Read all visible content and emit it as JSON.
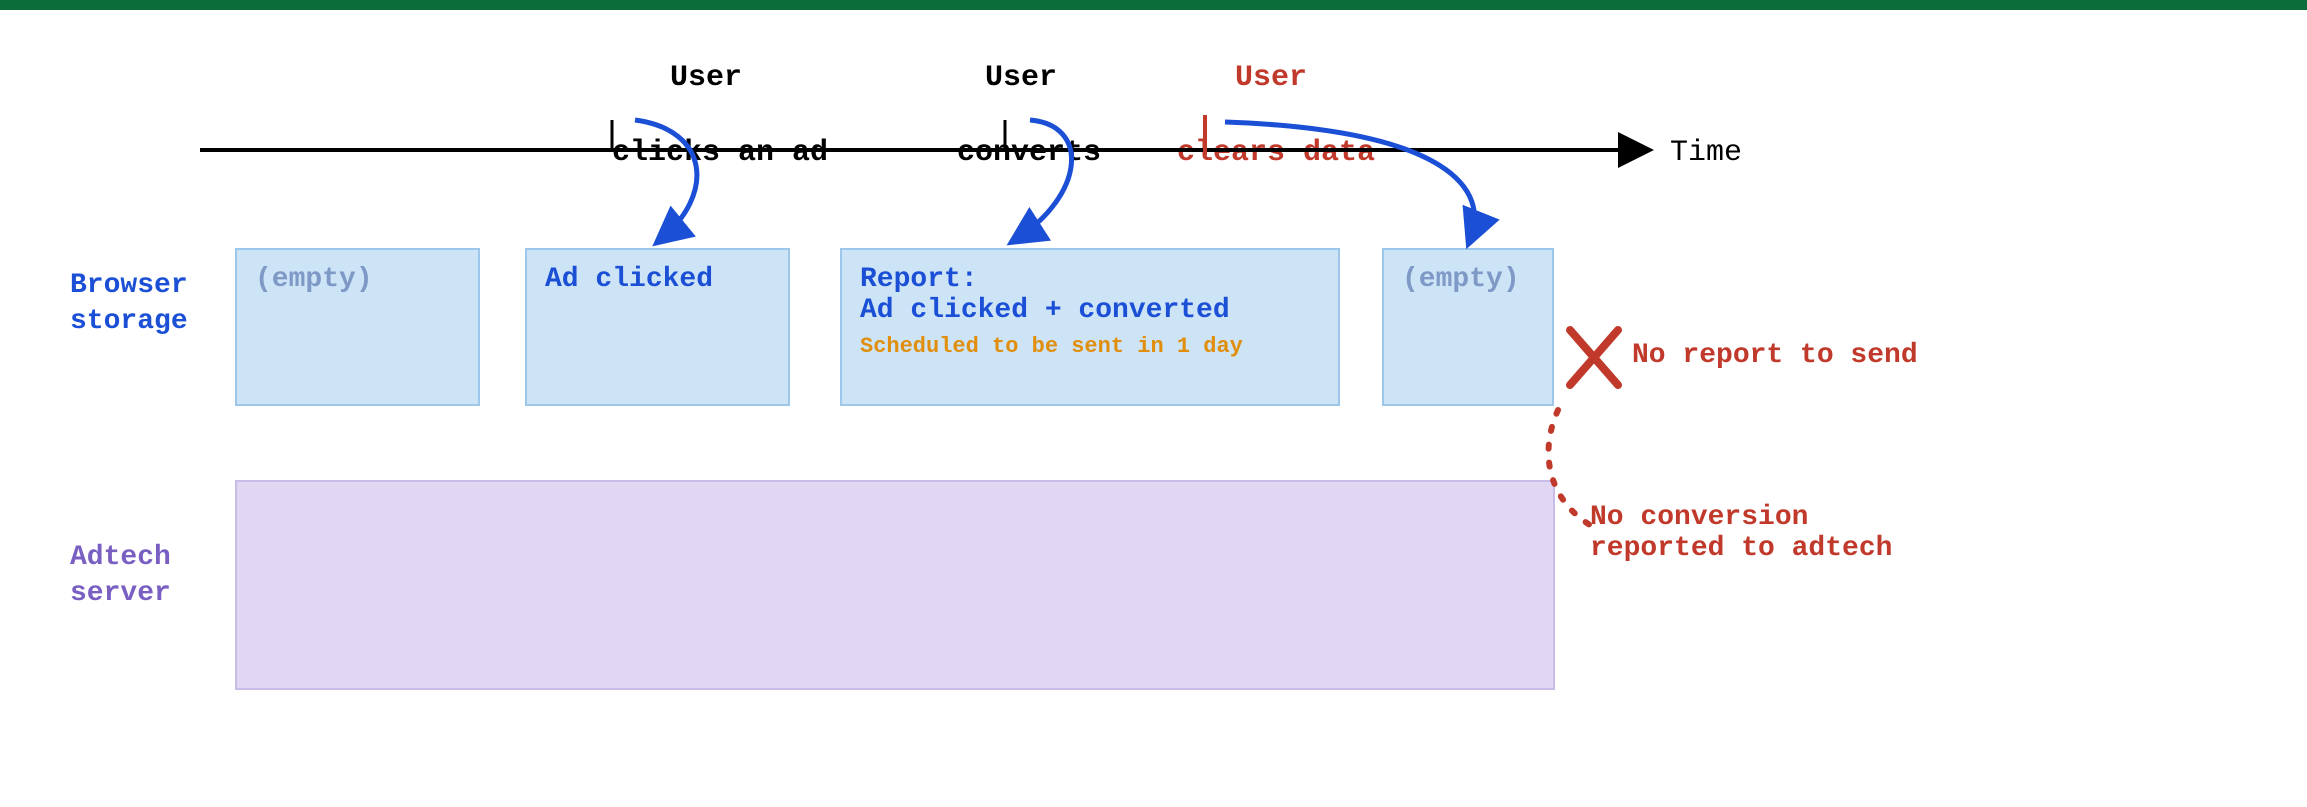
{
  "axis": {
    "label": "Time"
  },
  "events": {
    "click": {
      "line1": "User",
      "line2": "clicks an ad"
    },
    "convert": {
      "line1": "User",
      "line2": "converts"
    },
    "clear": {
      "line1": "User",
      "line2": "clears data"
    }
  },
  "rows": {
    "browser": {
      "label": "Browser\nstorage"
    },
    "adtech": {
      "label": "Adtech\nserver"
    }
  },
  "boxes": {
    "empty1": {
      "text": "(empty)"
    },
    "clicked": {
      "text": "Ad clicked"
    },
    "report": {
      "title": "Report:",
      "body": "Ad clicked + converted",
      "sub": "Scheduled to be sent in 1 day"
    },
    "empty2": {
      "text": "(empty)"
    }
  },
  "errors": {
    "nosend": "No report to send",
    "noconv": "No conversion\nreported to adtech"
  },
  "colors": {
    "blue_stroke": "#1a4fd6",
    "red": "#c0392b"
  }
}
